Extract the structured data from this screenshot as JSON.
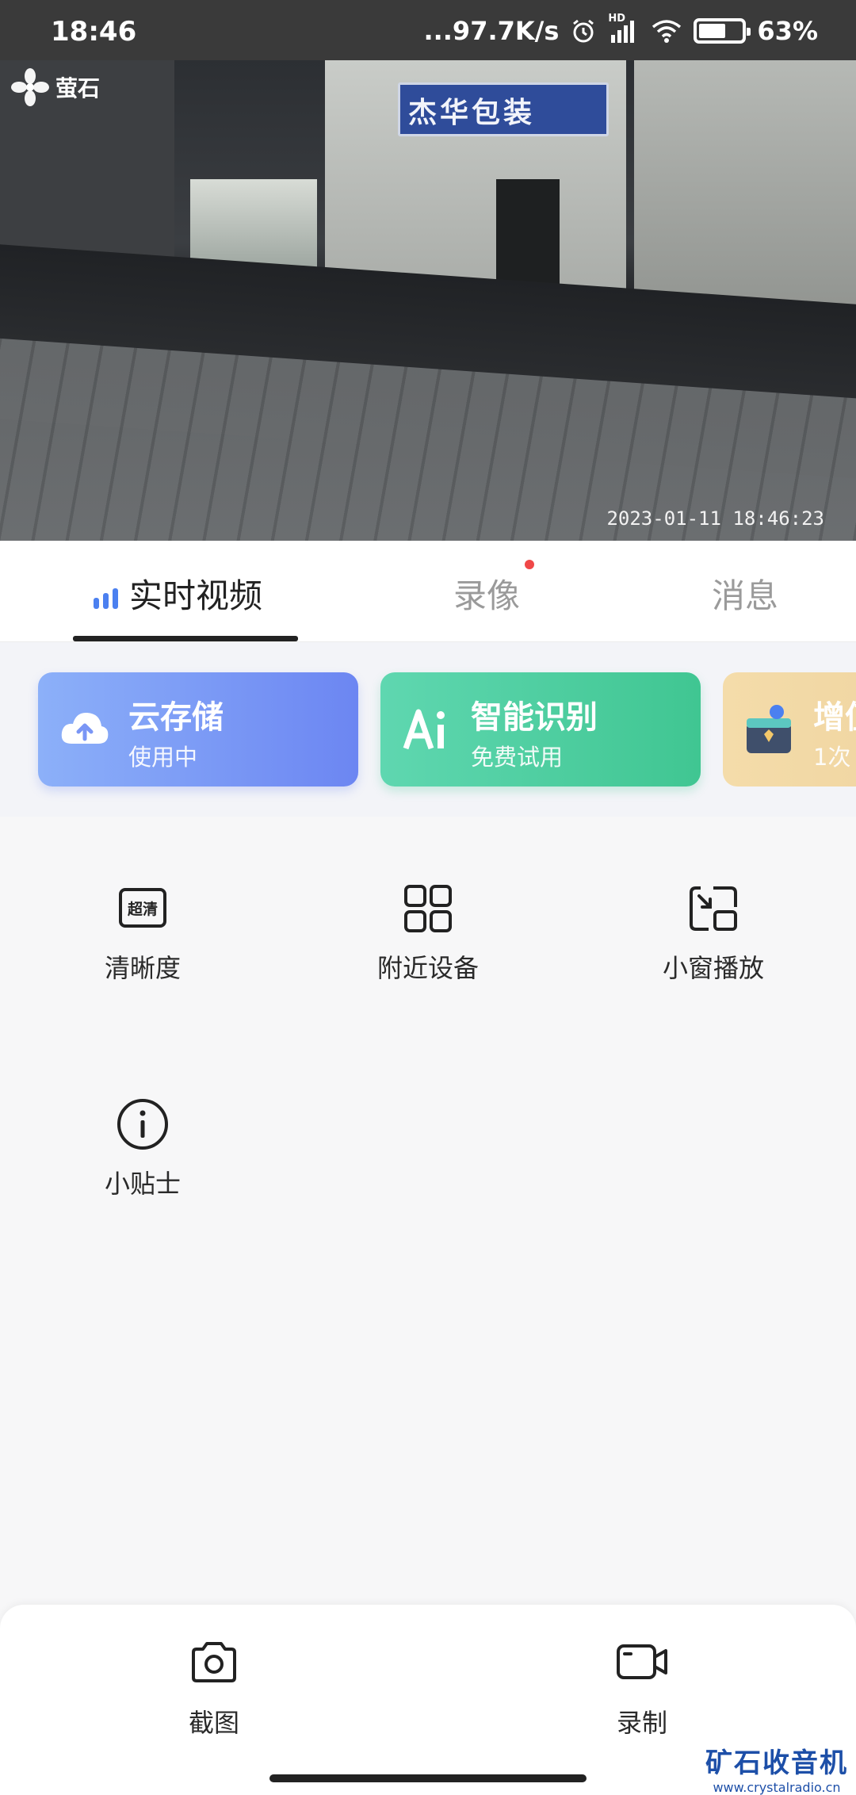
{
  "status_bar": {
    "time": "18:46",
    "network_speed": "...97.7K/s",
    "hd_label": "HD",
    "battery_percent": "63%",
    "battery_level": 0.63
  },
  "video": {
    "logo_text": "萤石",
    "shop_sign": "杰华包装",
    "timestamp": "2023-01-11 18:46:23"
  },
  "tabs": [
    {
      "label": "实时视频",
      "active": true
    },
    {
      "label": "录像",
      "active": false,
      "has_badge": true
    },
    {
      "label": "消息",
      "active": false
    }
  ],
  "service_cards": [
    {
      "title": "云存储",
      "subtitle": "使用中"
    },
    {
      "title": "智能识别",
      "subtitle": "免费试用"
    },
    {
      "title": "增值",
      "subtitle": "1次"
    }
  ],
  "functions": [
    {
      "label": "清晰度",
      "icon": "hd-quality-icon",
      "icon_text": "超清"
    },
    {
      "label": "附近设备",
      "icon": "grid-devices-icon"
    },
    {
      "label": "小窗播放",
      "icon": "picture-in-picture-icon"
    },
    {
      "label": "小贴士",
      "icon": "info-icon"
    }
  ],
  "bottom_actions": [
    {
      "label": "截图",
      "icon": "camera-icon"
    },
    {
      "label": "录制",
      "icon": "video-record-icon"
    }
  ],
  "watermark": {
    "title": "矿石收音机",
    "url": "www.crystalradio.cn"
  },
  "colors": {
    "accent_blue": "#4b80f0",
    "cloud_card": "#7a96f5",
    "ai_card": "#4fcea1",
    "plus_card": "#f0d5a2",
    "badge_red": "#f04848"
  }
}
